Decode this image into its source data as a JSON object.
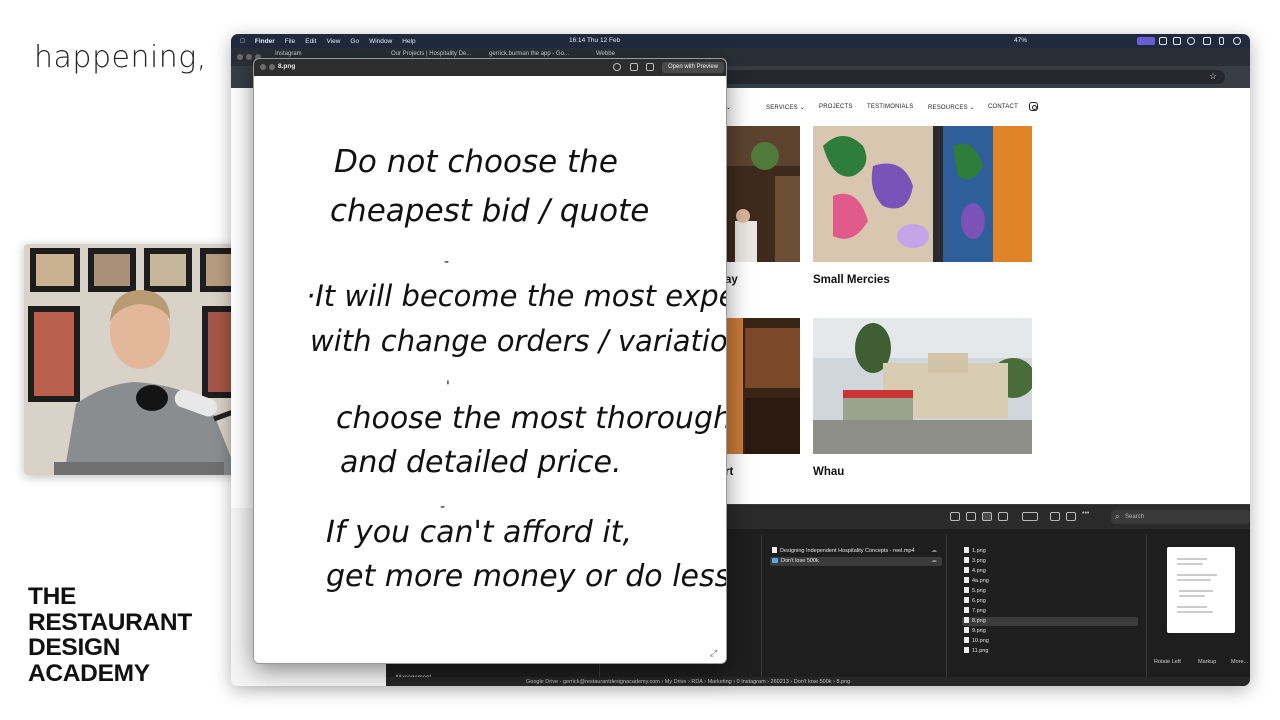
{
  "caption": "happening,",
  "brand": {
    "lines": [
      "THE",
      "RESTAURANT",
      "DESIGN",
      "ACADEMY"
    ]
  },
  "menubar": {
    "app": "Finder",
    "items": [
      "File",
      "Edit",
      "View",
      "Go",
      "Window",
      "Help"
    ],
    "clock": "16:14   Thu 12 Feb",
    "battery": "47%"
  },
  "browser": {
    "tabs": [
      "Instagram",
      "Our Projects | Hospitality De...",
      "gerrick.burman the app - Go...",
      "Webbe"
    ]
  },
  "website": {
    "nav": [
      "OUT ⌄",
      "SERVICES ⌄",
      "PROJECTS",
      "TESTIMONIALS",
      "RESOURCES ⌄",
      "CONTACT"
    ],
    "projects": [
      {
        "title": "ay"
      },
      {
        "title": "Small Mercies"
      },
      {
        "title": "rt"
      },
      {
        "title": "Whau"
      }
    ]
  },
  "preview": {
    "filename": "8.png",
    "open_with": "Open with Preview",
    "note_lines": [
      "Do not choose the",
      "cheapest bid / quote",
      "·It will become the most expensive",
      "with change orders / variations",
      "choose the most thorough",
      "and detailed price.",
      "If you can't afford it,",
      "get more money or do less"
    ]
  },
  "finder": {
    "search_placeholder": "Search",
    "column2": [
      {
        "name": "Designing Independent Hospitality Concepts - reel.mp4",
        "kind": "doc"
      },
      {
        "name": "Don't lose 500k",
        "kind": "folder",
        "selected": true
      }
    ],
    "column3": [
      "1.png",
      "3.png",
      "4.png",
      "4a.png",
      "5.png",
      "6.png",
      "7.png",
      "8.png",
      "9.png",
      "10.png",
      "11.png"
    ],
    "selected_file": "8.png",
    "preview_actions": [
      "Rotate Left",
      "Markup",
      "More..."
    ],
    "sidebar_item": "Management",
    "path": [
      "Google Drive - gerrick@restaurantdesignacademy.com",
      "My Drive",
      "RDA",
      "Marketing",
      "0 Instagram",
      "260213",
      "Don't lose 500k",
      "8.png"
    ]
  }
}
